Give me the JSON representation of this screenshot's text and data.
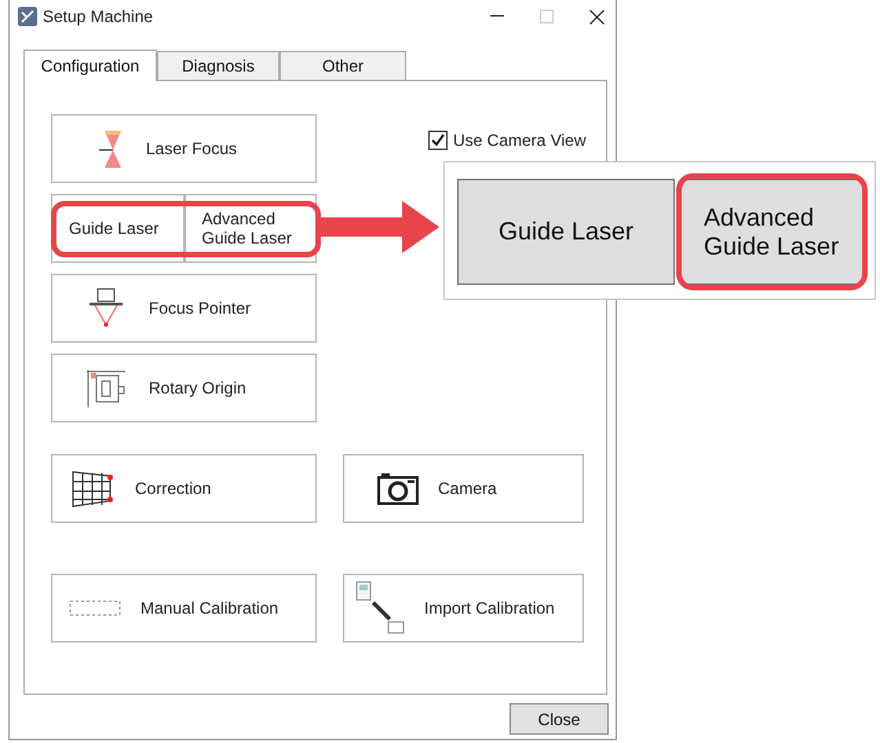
{
  "window": {
    "title": "Setup Machine"
  },
  "tabs": [
    {
      "label": "Configuration",
      "selected": true
    },
    {
      "label": "Diagnosis",
      "selected": false
    },
    {
      "label": "Other",
      "selected": false
    }
  ],
  "use_camera_view": {
    "label": "Use Camera View",
    "checked": true
  },
  "top_buttons": [
    {
      "kind": "icon",
      "label": "Laser Focus"
    },
    {
      "kind": "pair",
      "highlighted": true,
      "items": [
        {
          "label": "Guide Laser"
        },
        {
          "label": "Advanced Guide Laser"
        }
      ]
    },
    {
      "kind": "icon",
      "label": "Focus Pointer"
    },
    {
      "kind": "icon",
      "label": "Rotary Origin"
    }
  ],
  "bottom_buttons": [
    {
      "label": "Correction"
    },
    {
      "label": "Camera"
    },
    {
      "label": "Manual Calibration"
    },
    {
      "label": "Import Calibration"
    }
  ],
  "zoom_callout": {
    "buttons": [
      {
        "label": "Guide Laser",
        "highlighted": false
      },
      {
        "label": "Advanced Guide Laser",
        "highlighted": true
      }
    ]
  },
  "close_button": {
    "label": "Close"
  }
}
